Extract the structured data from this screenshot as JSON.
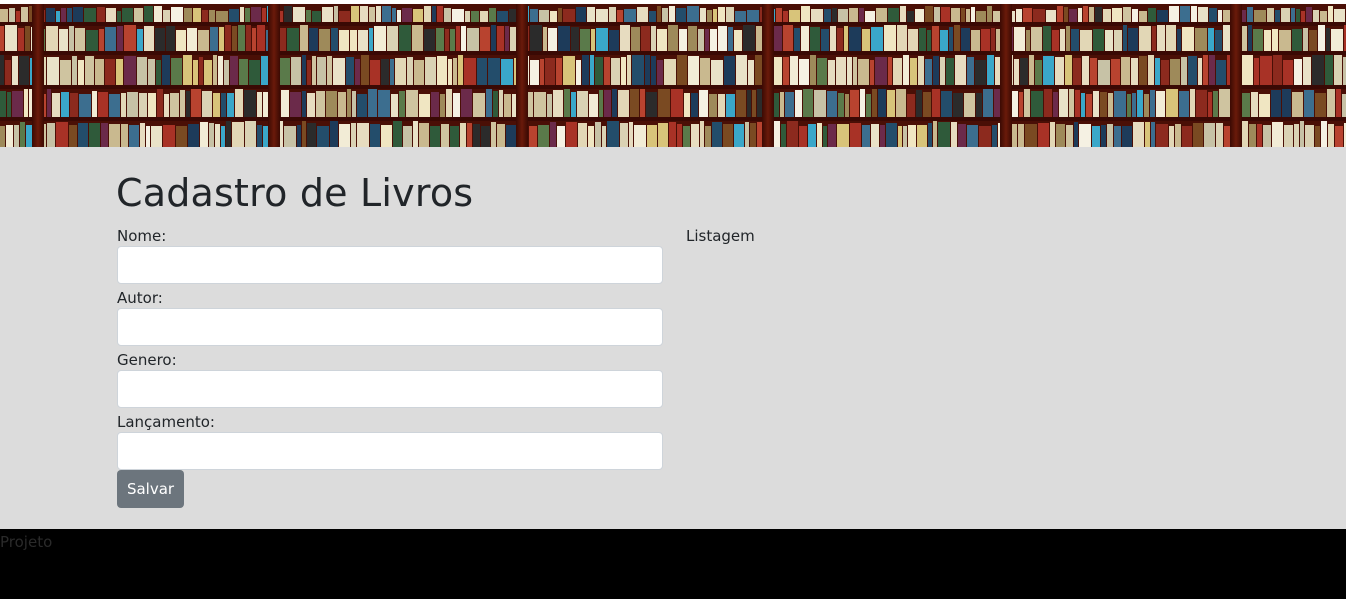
{
  "banner": {
    "image": "bookshelf-image"
  },
  "page": {
    "title": "Cadastro de Livros"
  },
  "form": {
    "fields": [
      {
        "label": "Nome:",
        "value": ""
      },
      {
        "label": "Autor:",
        "value": ""
      },
      {
        "label": "Genero:",
        "value": ""
      },
      {
        "label": "Lançamento:",
        "value": ""
      }
    ],
    "submit_label": "Salvar"
  },
  "listing": {
    "label": "Listagem"
  },
  "footer": {
    "text": "Projeto"
  },
  "colors": {
    "main_background": "#dcdcdc",
    "button": "#6c757d",
    "footer": "#000000"
  }
}
